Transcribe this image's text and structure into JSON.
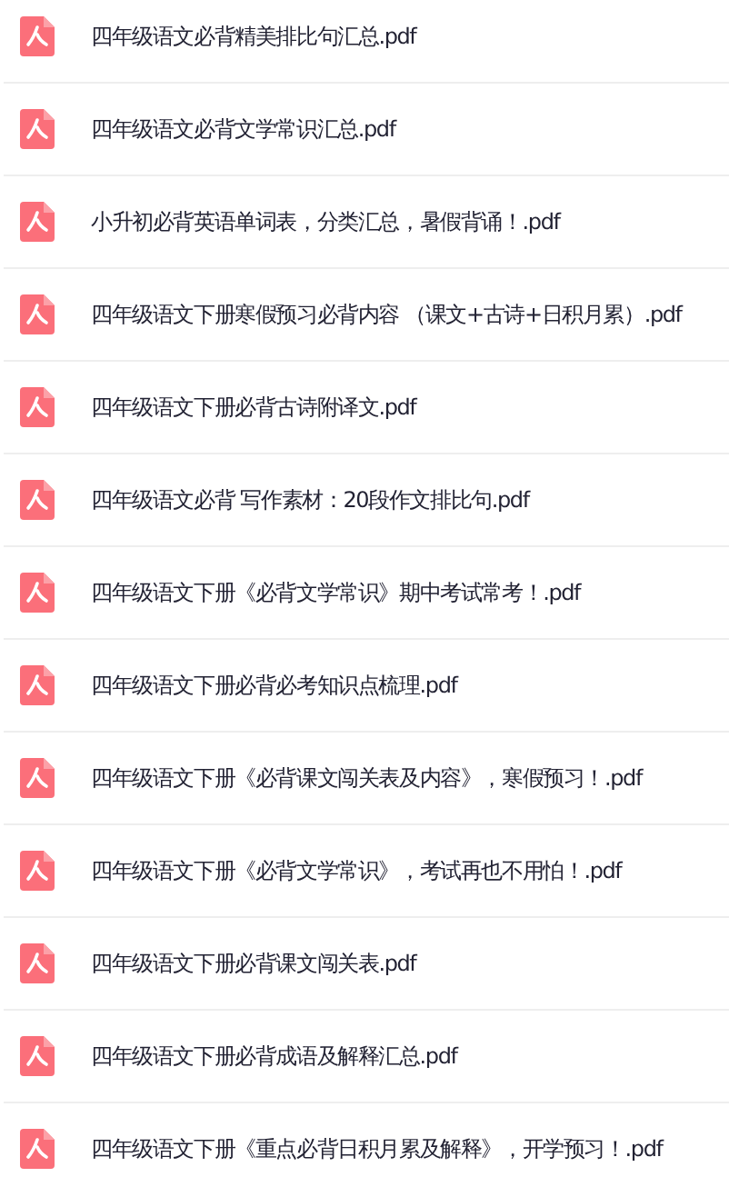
{
  "files": [
    {
      "name": "四年级语文必背精美排比句汇总.pdf"
    },
    {
      "name": "四年级语文必背文学常识汇总.pdf"
    },
    {
      "name": "小升初必背英语单词表，分类汇总，暑假背诵！.pdf"
    },
    {
      "name": "四年级语文下册寒假预习必背内容 （课文+古诗+日积月累）.pdf"
    },
    {
      "name": "四年级语文下册必背古诗附译文.pdf"
    },
    {
      "name": "四年级语文必背 写作素材：20段作文排比句.pdf"
    },
    {
      "name": "四年级语文下册《必背文学常识》期中考试常考！.pdf"
    },
    {
      "name": "四年级语文下册必背必考知识点梳理.pdf"
    },
    {
      "name": "四年级语文下册《必背课文闯关表及内容》，寒假预习！.pdf"
    },
    {
      "name": "四年级语文下册《必背文学常识》，考试再也不用怕！.pdf"
    },
    {
      "name": "四年级语文下册必背课文闯关表.pdf"
    },
    {
      "name": "四年级语文下册必背成语及解释汇总.pdf"
    },
    {
      "name": "四年级语文下册《重点必背日积月累及解释》，开学预习！.pdf"
    }
  ]
}
